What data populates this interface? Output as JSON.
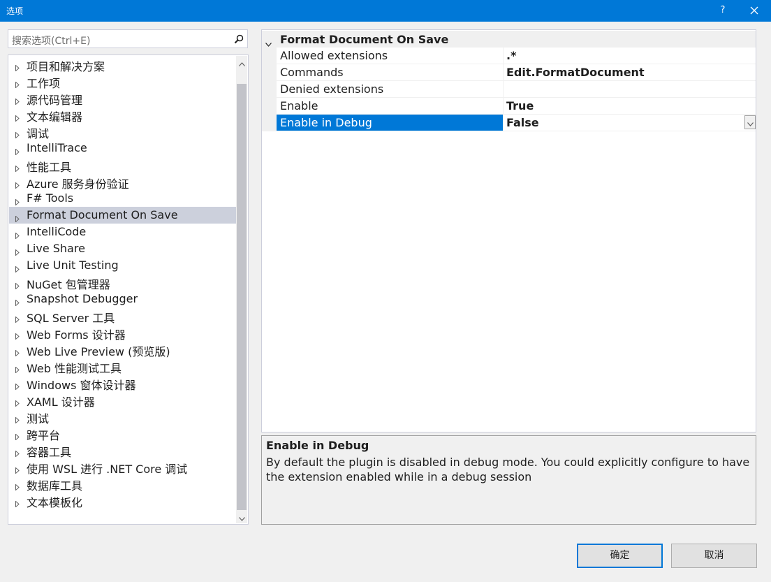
{
  "window": {
    "title": "选项",
    "help_glyph": "?",
    "title_color": "#0078d7"
  },
  "search": {
    "placeholder": "搜索选项(Ctrl+E)"
  },
  "tree": {
    "items": [
      {
        "label": "项目和解决方案"
      },
      {
        "label": "工作项"
      },
      {
        "label": "源代码管理"
      },
      {
        "label": "文本编辑器"
      },
      {
        "label": "调试"
      },
      {
        "label": "IntelliTrace"
      },
      {
        "label": "性能工具"
      },
      {
        "label": "Azure 服务身份验证"
      },
      {
        "label": "F# Tools"
      },
      {
        "label": "Format Document On Save",
        "selected": true
      },
      {
        "label": "IntelliCode"
      },
      {
        "label": "Live Share"
      },
      {
        "label": "Live Unit Testing"
      },
      {
        "label": "NuGet 包管理器"
      },
      {
        "label": "Snapshot Debugger"
      },
      {
        "label": "SQL Server 工具"
      },
      {
        "label": "Web Forms 设计器"
      },
      {
        "label": "Web Live Preview (预览版)"
      },
      {
        "label": "Web 性能测试工具"
      },
      {
        "label": "Windows 窗体设计器"
      },
      {
        "label": "XAML 设计器"
      },
      {
        "label": "测试"
      },
      {
        "label": "跨平台"
      },
      {
        "label": "容器工具"
      },
      {
        "label": "使用 WSL 进行 .NET Core 调试"
      },
      {
        "label": "数据库工具"
      },
      {
        "label": "文本模板化"
      }
    ]
  },
  "grid": {
    "category": "Format Document On Save",
    "properties": [
      {
        "name": "Allowed extensions",
        "value": ".*"
      },
      {
        "name": "Commands",
        "value": "Edit.FormatDocument"
      },
      {
        "name": "Denied extensions",
        "value": ""
      },
      {
        "name": "Enable",
        "value": "True"
      },
      {
        "name": "Enable in Debug",
        "value": "False",
        "selected": true
      }
    ]
  },
  "description": {
    "title": "Enable in Debug",
    "text": "By default the plugin is disabled in debug mode. You could explicitly configure to have the extension enabled while in a debug session"
  },
  "buttons": {
    "ok": "确定",
    "cancel": "取消"
  }
}
